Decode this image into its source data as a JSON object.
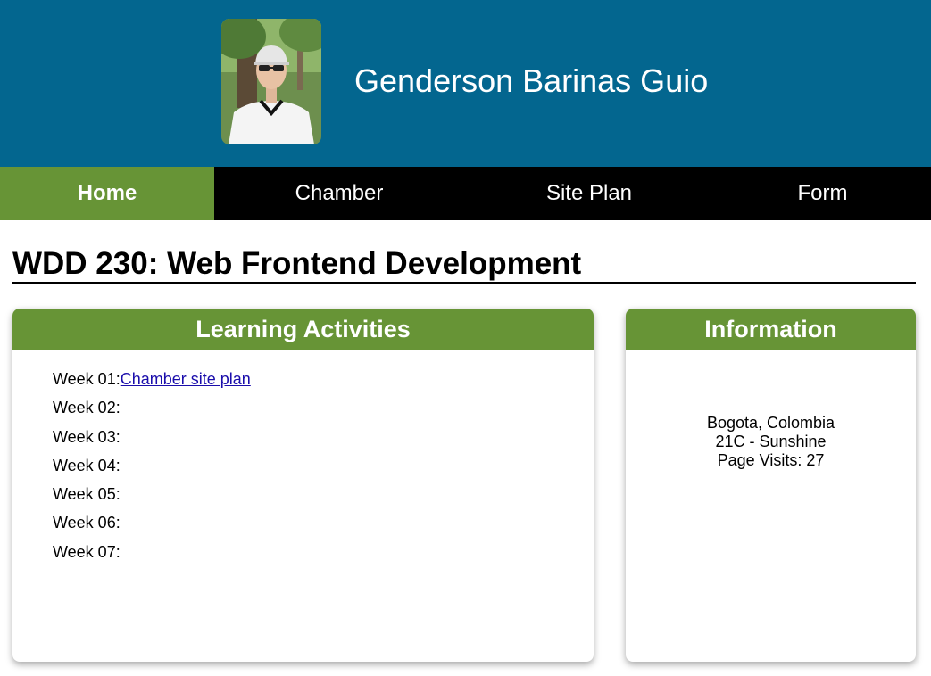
{
  "header": {
    "name": "Genderson Barinas Guio",
    "avatar_icon": "profile-photo"
  },
  "nav": {
    "items": [
      {
        "label": "Home",
        "active": true
      },
      {
        "label": "Chamber",
        "active": false
      },
      {
        "label": "Site Plan",
        "active": false
      },
      {
        "label": "Form",
        "active": false
      }
    ]
  },
  "main": {
    "title": "WDD 230: Web Frontend Development"
  },
  "learning": {
    "heading": "Learning Activities",
    "weeks": [
      {
        "label": "Week 01:",
        "link": "Chamber site plan"
      },
      {
        "label": "Week 02:",
        "link": ""
      },
      {
        "label": "Week 03:",
        "link": ""
      },
      {
        "label": "Week 04:",
        "link": ""
      },
      {
        "label": "Week 05:",
        "link": ""
      },
      {
        "label": "Week 06:",
        "link": ""
      },
      {
        "label": "Week 07:",
        "link": ""
      }
    ]
  },
  "information": {
    "heading": "Information",
    "location": "Bogota, Colombia",
    "weather": "21C - Sunshine",
    "visits": "Page Visits: 27"
  },
  "colors": {
    "header_bg": "#03668f",
    "accent_green": "#679436",
    "nav_bg": "#000000"
  }
}
